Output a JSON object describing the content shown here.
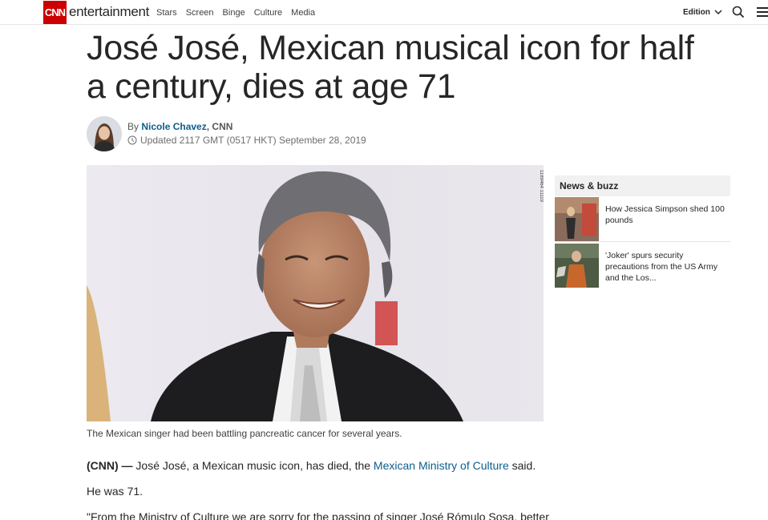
{
  "header": {
    "logo_text": "CNN",
    "section_name": "entertainment",
    "nav": [
      "Stars",
      "Screen",
      "Binge",
      "Culture",
      "Media"
    ],
    "edition_label": "Edition",
    "icons": {
      "search": "search-icon",
      "menu": "menu-icon",
      "edition_chevron": "chevron-down-icon"
    }
  },
  "article": {
    "headline": "José José, Mexican musical icon for half a century, dies at age 71",
    "byline_prefix": "By",
    "author": "Nicole Chavez",
    "author_suffix": ", CNN",
    "updated": "Updated 2117 GMT (0517 HKT) September 28, 2019",
    "image_caption": "The Mexican singer had been battling pancreatic cancer for several years.",
    "lead_label": "(CNN) —",
    "p1_text": " José José, a Mexican music icon, has died, the ",
    "p1_link": "Mexican Ministry of Culture",
    "p1_end": " said.",
    "p2": "He was 71.",
    "p3": "\"From the Ministry of Culture we are sorry for the passing of singer José Rómulo Sosa, better"
  },
  "sidebar": {
    "title": "News & buzz",
    "items": [
      {
        "text": "How Jessica Simpson shed 100 pounds"
      },
      {
        "text": "'Joker' spurs security precautions from the US Army and the Los..."
      }
    ]
  },
  "colors": {
    "brand": "#cc0000",
    "link": "#0c5e8c"
  }
}
